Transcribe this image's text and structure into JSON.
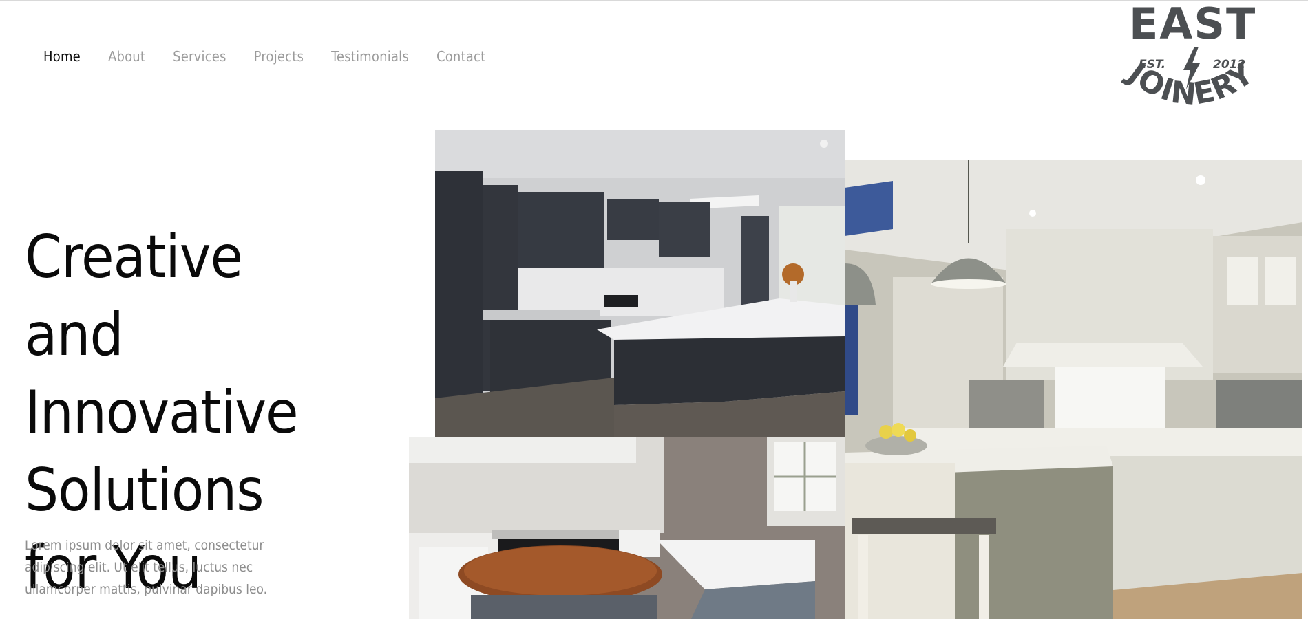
{
  "nav": {
    "items": [
      {
        "label": "Home",
        "active": true
      },
      {
        "label": "About"
      },
      {
        "label": "Services"
      },
      {
        "label": "Projects"
      },
      {
        "label": "Testimonials"
      },
      {
        "label": "Contact"
      }
    ]
  },
  "logo": {
    "top_word": "EAST",
    "est_label": "EST.",
    "year": "2012",
    "arc_word": "JOINERY",
    "color": "#4c4f52"
  },
  "hero": {
    "title": "Creative and Innovative Solutions for You",
    "text": " Lorem ipsum dolor sit amet, consectetur adipiscing elit. Ut elit tellus, luctus nec ullamcorper mattis, pulvinar dapibus leo."
  },
  "photos": [
    {
      "subject": "dark grey kitchen with island"
    },
    {
      "subject": "white kitchen with round wooden worktop"
    },
    {
      "subject": "cream shaker kitchen with pendant lights"
    }
  ],
  "colors": {
    "nav_active": "#111111",
    "nav_inactive": "#9b9b9b",
    "title": "#0a0a0a",
    "body_text": "#8e8e8e"
  }
}
